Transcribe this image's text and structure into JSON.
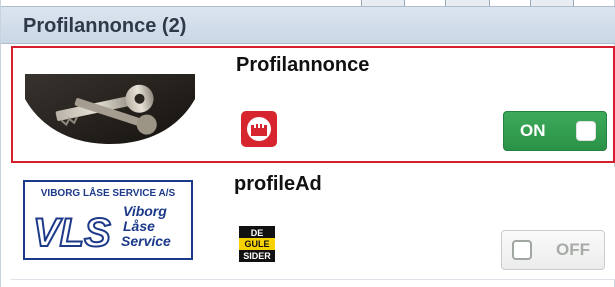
{
  "panel": {
    "title": "Profilannonce (2)"
  },
  "items": [
    {
      "title": "Profilannonce",
      "thumbnail": "keys-photo",
      "source_icon": "red-castle-icon",
      "toggle": {
        "label": "ON",
        "state": "on"
      },
      "selected": true
    },
    {
      "title": "profileAd",
      "thumbnail": "vls-logo",
      "logo_text": {
        "top": "VIBORG LÅSE SERVICE A/S",
        "monogram": "VLS",
        "line1": "Viborg",
        "line2": "Låse",
        "line3": "Service"
      },
      "source_icon": "de-gule-sider-icon",
      "source_icon_text": [
        "DE",
        "GULE",
        "SIDER"
      ],
      "toggle": {
        "label": "OFF",
        "state": "off"
      },
      "selected": false
    }
  ],
  "colors": {
    "selected_border": "#d4202d",
    "toggle_on": "#2f9a4c",
    "header_bg": "#cfdbe7"
  }
}
